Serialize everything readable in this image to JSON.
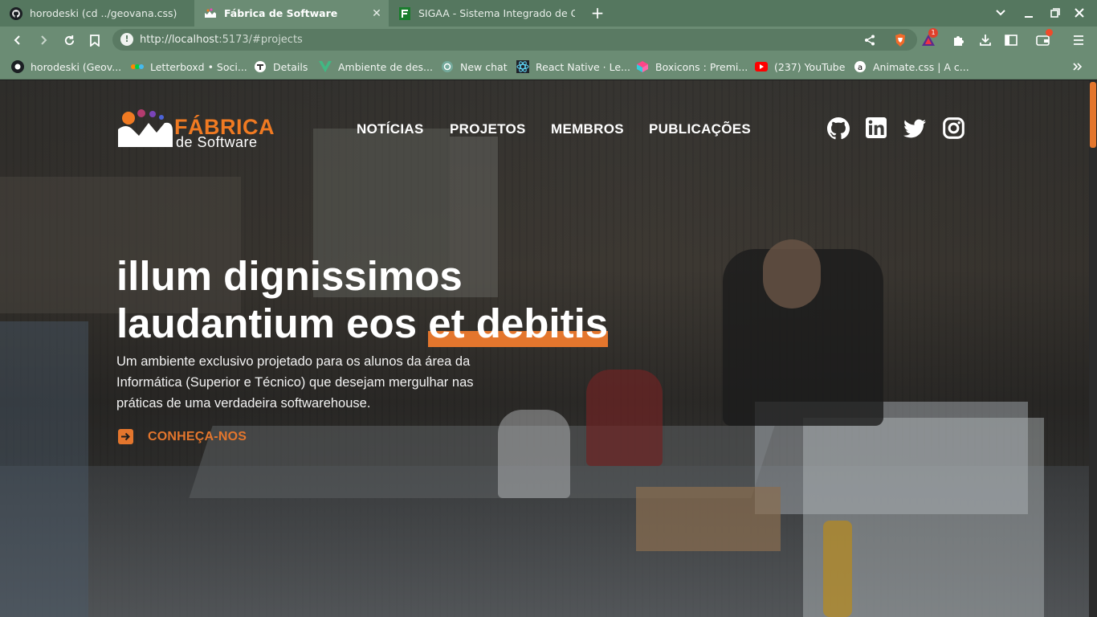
{
  "browser": {
    "tabs": [
      {
        "title": "horodeski (cd ../geovana.css)",
        "icon": "github-icon",
        "active": false
      },
      {
        "title": "Fábrica de Software",
        "icon": "fabrica-icon",
        "active": true
      },
      {
        "title": "SIGAA - Sistema Integrado de Gest",
        "icon": "sigaa-icon",
        "active": false
      }
    ],
    "url_host": "http://localhost",
    "url_rest": ":5173/#projects",
    "brave_badge": "1",
    "bookmarks": [
      {
        "label": "horodeski (Geov...",
        "icon": "github-icon"
      },
      {
        "label": "Letterboxd • Soci...",
        "icon": "letterboxd-icon"
      },
      {
        "label": "Details",
        "icon": "details-icon"
      },
      {
        "label": "Ambiente de des...",
        "icon": "vue-icon"
      },
      {
        "label": "New chat",
        "icon": "openai-icon"
      },
      {
        "label": "React Native · Le...",
        "icon": "react-icon"
      },
      {
        "label": "Boxicons : Premi...",
        "icon": "boxicons-icon"
      },
      {
        "label": "(237) YouTube",
        "icon": "youtube-icon"
      },
      {
        "label": "Animate.css | A c...",
        "icon": "animate-icon"
      }
    ]
  },
  "site": {
    "logo_line1": "FÁBRICA",
    "logo_line2": "de Software",
    "nav": [
      "NOTÍCIAS",
      "PROJETOS",
      "MEMBROS",
      "PUBLICAÇÕES"
    ],
    "social": [
      "github-icon",
      "linkedin-icon",
      "twitter-icon",
      "instagram-icon"
    ],
    "headline_line1": "illum dignissimos",
    "headline_line2_plain": "laudantium eos ",
    "headline_line2_highlight": "et debitis",
    "subtitle": "Um ambiente exclusivo projetado para os alunos da área da Informática (Superior e Técnico) que desejam mergulhar nas práticas de uma verdadeira softwarehouse.",
    "cta_label": "CONHEÇA-NOS"
  },
  "colors": {
    "accent": "#e4762d",
    "chrome": "#6b8c74",
    "tabbar": "#55775f"
  }
}
